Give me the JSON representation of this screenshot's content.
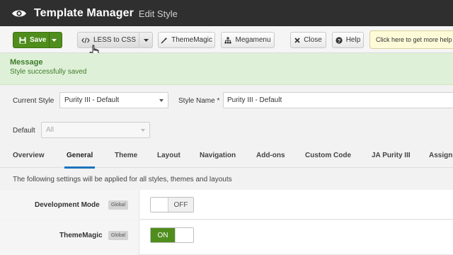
{
  "header": {
    "title": "Template Manager",
    "subtitle": "Edit Style"
  },
  "toolbar": {
    "save_label": "Save",
    "less_label": "LESS to CSS",
    "thememagic_label": "ThemeMagic",
    "megamenu_label": "Megamenu",
    "close_label": "Close",
    "help_label": "Help",
    "tooltip": "Click here to get more help"
  },
  "message": {
    "title": "Message",
    "text": "Style successfully saved"
  },
  "form": {
    "current_style_label": "Current Style",
    "current_style_value": "Purity III - Default",
    "style_name_label": "Style Name *",
    "style_name_value": "Purity III - Default",
    "default_label": "Default",
    "default_value": "All"
  },
  "tabs": [
    "Overview",
    "General",
    "Theme",
    "Layout",
    "Navigation",
    "Add-ons",
    "Custom Code",
    "JA Purity III",
    "Assign"
  ],
  "active_tab": "General",
  "settings": {
    "description": "The following settings will be applied for all styles, themes and layouts",
    "rows": [
      {
        "label": "Development Mode",
        "badge": "Global",
        "state": "OFF"
      },
      {
        "label": "ThemeMagic",
        "badge": "Global",
        "state": "ON"
      }
    ]
  },
  "colors": {
    "header_bg": "#2f2f2f",
    "save_green": "#4f8d1c",
    "message_bg": "#dff0d8",
    "tab_accent": "#1e73be"
  }
}
